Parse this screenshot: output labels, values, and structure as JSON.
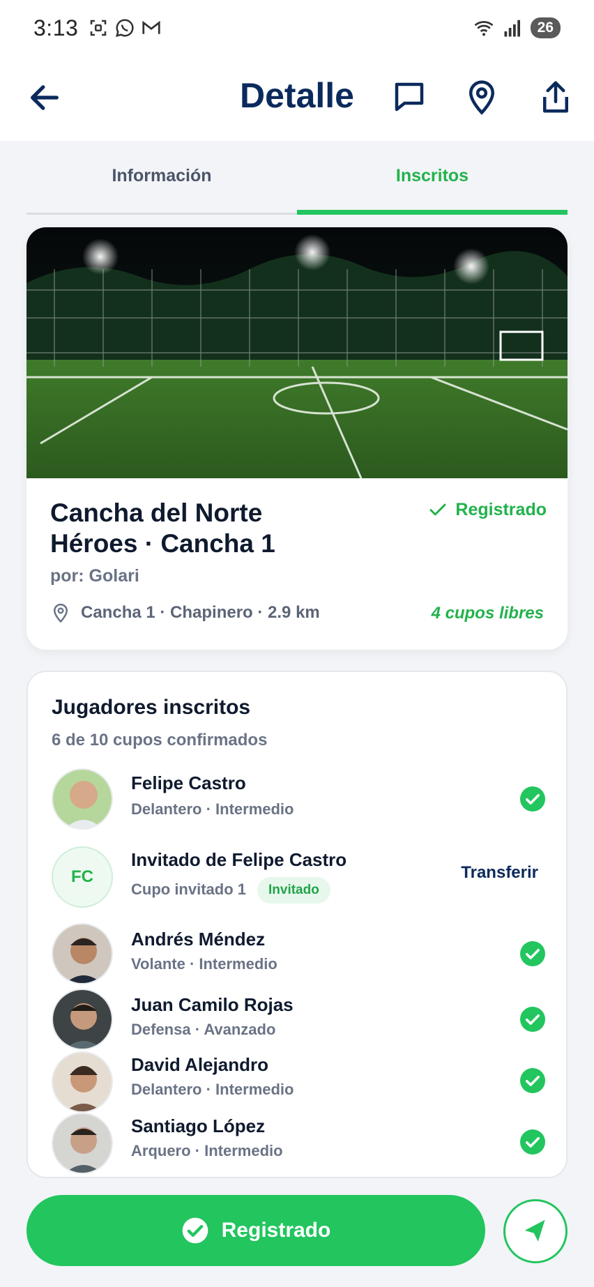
{
  "status_bar": {
    "time": "3:13",
    "battery": "26",
    "icons": [
      "screenshot-icon",
      "whatsapp-icon",
      "gmail-icon",
      "wifi-icon",
      "signal-icon",
      "battery-icon"
    ]
  },
  "app_bar": {
    "title": "Detalle",
    "icons": [
      "back-arrow-icon",
      "chat-icon",
      "location-pin-icon",
      "share-icon"
    ]
  },
  "tabs": [
    {
      "label": "Información",
      "active": false
    },
    {
      "label": "Inscritos",
      "active": true
    }
  ],
  "venue": {
    "name_line1": "Cancha del Norte",
    "name_line2": "Héroes · Cancha 1",
    "status": "Registrado",
    "organizer": "por: Golari",
    "location": "Cancha 1 · Chapinero · 2.9 km",
    "spots": "4 cupos libres"
  },
  "players_section": {
    "title": "Jugadores inscritos",
    "subtitle": "6 de 10 cupos confirmados",
    "players": [
      {
        "name": "Felipe Castro",
        "meta": "Delantero · Intermedio",
        "confirmed": true
      },
      {
        "name": "Invitado de Felipe Castro",
        "meta": "Cupo invitado 1",
        "initials": "FC",
        "badge": "Invitado",
        "action": "Transferir"
      },
      {
        "name": "Andrés Méndez",
        "meta": "Volante · Intermedio",
        "confirmed": true
      },
      {
        "name": "Juan Camilo Rojas",
        "meta": "Defensa · Avanzado",
        "confirmed": true
      },
      {
        "name": "David Alejandro",
        "meta": "Delantero · Intermedio",
        "confirmed": true
      },
      {
        "name": "Santiago López",
        "meta": "Arquero · Intermedio",
        "confirmed": true
      }
    ]
  },
  "footer": {
    "cta_label": "Registrado",
    "nav_icon": "navigate-arrow-icon"
  },
  "colors": {
    "brand_navy": "#0b2a5c",
    "accent_green": "#22c55e",
    "background": "#f2f4f7"
  }
}
